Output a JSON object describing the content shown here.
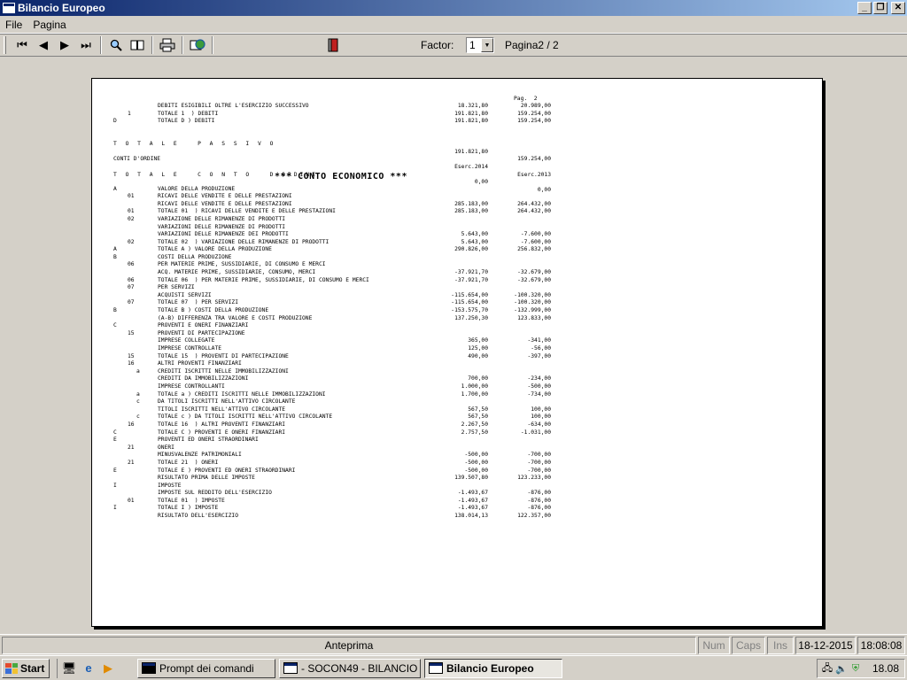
{
  "window": {
    "title": "Bilancio Europeo"
  },
  "menu": {
    "file": "File",
    "pagina": "Pagina"
  },
  "toolbar": {
    "factor_label": "Factor:",
    "factor_value": "1",
    "page_indicator": "Pagina2 / 2",
    "icons": [
      "first-page-icon",
      "prev-page-icon",
      "next-page-icon",
      "last-page-icon",
      "zoom-icon",
      "book-icon",
      "print-icon",
      "export-icon",
      "exit-door-icon"
    ]
  },
  "report": {
    "page_label": "Pag.  2",
    "section_title": "*** CONTO ECONOMICO ***",
    "rows_top": [
      {
        "c1": "",
        "c2": "",
        "c3": "",
        "desc": "DEBITI ESIGIBILI OLTRE L'ESERCIZIO SUCCESSIVO",
        "v1": "18.321,80",
        "v2": "20.989,00"
      },
      {
        "c1": "",
        "c2": "1",
        "c3": "",
        "desc": "TOTALE 1  ) DEBITI",
        "v1": "191.821,80",
        "v2": "159.254,00"
      },
      {
        "c1": "D",
        "c2": "",
        "c3": "",
        "desc": "TOTALE D ) DEBITI",
        "v1": "191.821,80",
        "v2": "159.254,00"
      }
    ],
    "totale_passivo": {
      "label": "T O T A L E   P A S S I V O",
      "v1": "191.821,80",
      "v2": "159.254,00"
    },
    "conti_ordine": {
      "label": "CONTI D'ORDINE",
      "v1": "Eserc.2014",
      "v2": "Eserc.2013"
    },
    "totale_conto_ordine": {
      "label": "T O T A L E   C O N T O   D'ORDINE",
      "v1": "0,00",
      "v2": "0,00"
    },
    "rows_ce": [
      {
        "c1": "A",
        "c2": "",
        "c3": "",
        "desc": "VALORE DELLA PRODUZIONE",
        "v1": "",
        "v2": ""
      },
      {
        "c1": "",
        "c2": "01",
        "c3": "",
        "desc": "RICAVI DELLE VENDITE E DELLE PRESTAZIONI",
        "v1": "",
        "v2": ""
      },
      {
        "c1": "",
        "c2": "",
        "c3": "",
        "desc": "RICAVI DELLE VENDITE E DELLE PRESTAZIONI",
        "v1": "285.183,00",
        "v2": "264.432,00"
      },
      {
        "c1": "",
        "c2": "01",
        "c3": "",
        "desc": "TOTALE 01  ) RICAVI DELLE VENDITE E DELLE PRESTAZIONI",
        "v1": "285.183,00",
        "v2": "264.432,00"
      },
      {
        "c1": "",
        "c2": "02",
        "c3": "",
        "desc": "VARIAZIONE DELLE RIMANENZE DI PRODOTTI",
        "v1": "",
        "v2": ""
      },
      {
        "c1": "",
        "c2": "",
        "c3": "",
        "desc": "VARIAZIONI DELLE RIMANENZE DI PRODOTTI",
        "v1": "",
        "v2": ""
      },
      {
        "c1": "",
        "c2": "",
        "c3": "",
        "desc": "VARIAZIONI DELLE RIMANENZE DEI PRODOTTI",
        "v1": "5.643,00",
        "v2": "-7.600,00"
      },
      {
        "c1": "",
        "c2": "02",
        "c3": "",
        "desc": "TOTALE 02  ) VARIAZIONE DELLE RIMANENZE DI PRODOTTI",
        "v1": "5.643,00",
        "v2": "-7.600,00"
      },
      {
        "c1": "A",
        "c2": "",
        "c3": "",
        "desc": "TOTALE A ) VALORE DELLA PRODUZIONE",
        "v1": "290.826,00",
        "v2": "256.832,00"
      },
      {
        "c1": "B",
        "c2": "",
        "c3": "",
        "desc": "COSTI DELLA PRODUZIONE",
        "v1": "",
        "v2": ""
      },
      {
        "c1": "",
        "c2": "06",
        "c3": "",
        "desc": "PER MATERIE PRIME, SUSSIDIARIE, DI CONSUMO E MERCI",
        "v1": "",
        "v2": ""
      },
      {
        "c1": "",
        "c2": "",
        "c3": "",
        "desc": "ACQ. MATERIE PRIME, SUSSIDIARIE, CONSUMO, MERCI",
        "v1": "-37.921,70",
        "v2": "-32.679,00"
      },
      {
        "c1": "",
        "c2": "06",
        "c3": "",
        "desc": "TOTALE 06  ) PER MATERIE PRIME, SUSSIDIARIE, DI CONSUMO E MERCI",
        "v1": "-37.921,70",
        "v2": "-32.679,00"
      },
      {
        "c1": "",
        "c2": "07",
        "c3": "",
        "desc": "PER SERVIZI",
        "v1": "",
        "v2": ""
      },
      {
        "c1": "",
        "c2": "",
        "c3": "",
        "desc": "ACQUISTI SERVIZI",
        "v1": "-115.654,00",
        "v2": "-100.320,00"
      },
      {
        "c1": "",
        "c2": "07",
        "c3": "",
        "desc": "TOTALE 07  ) PER SERVIZI",
        "v1": "-115.654,00",
        "v2": "-100.320,00"
      },
      {
        "c1": "B",
        "c2": "",
        "c3": "",
        "desc": "TOTALE B ) COSTI DELLA PRODUZIONE",
        "v1": "-153.575,70",
        "v2": "-132.999,00"
      },
      {
        "c1": "",
        "c2": "",
        "c3": "",
        "desc": "(A-B) DIFFERENZA TRA VALORE E COSTI PRODUZIONE",
        "v1": "137.250,30",
        "v2": "123.833,00"
      },
      {
        "c1": "C",
        "c2": "",
        "c3": "",
        "desc": "PROVENTI E ONERI FINANZIARI",
        "v1": "",
        "v2": ""
      },
      {
        "c1": "",
        "c2": "15",
        "c3": "",
        "desc": "PROVENTI DI PARTECIPAZIONE",
        "v1": "",
        "v2": ""
      },
      {
        "c1": "",
        "c2": "",
        "c3": "",
        "desc": "IMPRESE COLLEGATE",
        "v1": "365,00",
        "v2": "-341,00"
      },
      {
        "c1": "",
        "c2": "",
        "c3": "",
        "desc": "IMPRESE CONTROLLATE",
        "v1": "125,00",
        "v2": "-56,00"
      },
      {
        "c1": "",
        "c2": "15",
        "c3": "",
        "desc": "TOTALE 15  ) PROVENTI DI PARTECIPAZIONE",
        "v1": "490,00",
        "v2": "-397,00"
      },
      {
        "c1": "",
        "c2": "16",
        "c3": "",
        "desc": "ALTRI PROVENTI FINANZIARI",
        "v1": "",
        "v2": ""
      },
      {
        "c1": "",
        "c2": "",
        "c3": "a",
        "desc": "CREDITI ISCRITTI NELLE IMMOBILIZZAZIONI",
        "v1": "",
        "v2": ""
      },
      {
        "c1": "",
        "c2": "",
        "c3": "",
        "desc": "CREDITI DA IMMOBILIZZAZIONI",
        "v1": "700,00",
        "v2": "-234,00"
      },
      {
        "c1": "",
        "c2": "",
        "c3": "",
        "desc": "IMPRESE CONTROLLANTI",
        "v1": "1.000,00",
        "v2": "-500,00"
      },
      {
        "c1": "",
        "c2": "",
        "c3": "a",
        "desc": "TOTALE a ) CREDITI ISCRITTI NELLE IMMOBILIZZAZIONI",
        "v1": "1.700,00",
        "v2": "-734,00"
      },
      {
        "c1": "",
        "c2": "",
        "c3": "c",
        "desc": "DA TITOLI ISCRITTI NELL'ATTIVO CIRCOLANTE",
        "v1": "",
        "v2": ""
      },
      {
        "c1": "",
        "c2": "",
        "c3": "",
        "desc": "TITOLI ISCRITTI NELL'ATTIVO CIRCOLANTE",
        "v1": "567,50",
        "v2": "100,00"
      },
      {
        "c1": "",
        "c2": "",
        "c3": "c",
        "desc": "TOTALE c ) DA TITOLI ISCRITTI NELL'ATTIVO CIRCOLANTE",
        "v1": "567,50",
        "v2": "100,00"
      },
      {
        "c1": "",
        "c2": "16",
        "c3": "",
        "desc": "TOTALE 16  ) ALTRI PROVENTI FINANZIARI",
        "v1": "2.267,50",
        "v2": "-634,00"
      },
      {
        "c1": "C",
        "c2": "",
        "c3": "",
        "desc": "TOTALE C ) PROVENTI E ONERI FINANZIARI",
        "v1": "2.757,50",
        "v2": "-1.031,00"
      },
      {
        "c1": "E",
        "c2": "",
        "c3": "",
        "desc": "PROVENTI ED ONERI STRAORDINARI",
        "v1": "",
        "v2": ""
      },
      {
        "c1": "",
        "c2": "21",
        "c3": "",
        "desc": "ONERI",
        "v1": "",
        "v2": ""
      },
      {
        "c1": "",
        "c2": "",
        "c3": "",
        "desc": "MINUSVALENZE PATRIMONIALI",
        "v1": "-500,00",
        "v2": "-700,00"
      },
      {
        "c1": "",
        "c2": "21",
        "c3": "",
        "desc": "TOTALE 21  ) ONERI",
        "v1": "-500,00",
        "v2": "-700,00"
      },
      {
        "c1": "E",
        "c2": "",
        "c3": "",
        "desc": "TOTALE E ) PROVENTI ED ONERI STRAORDINARI",
        "v1": "-500,00",
        "v2": "-700,00"
      },
      {
        "c1": "",
        "c2": "",
        "c3": "",
        "desc": "RISULTATO PRIMA DELLE IMPOSTE",
        "v1": "139.507,80",
        "v2": "123.233,00"
      },
      {
        "c1": "I",
        "c2": "",
        "c3": "",
        "desc": "IMPOSTE",
        "v1": "",
        "v2": ""
      },
      {
        "c1": "",
        "c2": "",
        "c3": "",
        "desc": "IMPOSTE SUL REDDITO DELL'ESERCIZIO",
        "v1": "-1.493,67",
        "v2": "-876,00"
      },
      {
        "c1": "",
        "c2": "01",
        "c3": "",
        "desc": "TOTALE 01  ) IMPOSTE",
        "v1": "-1.493,67",
        "v2": "-876,00"
      },
      {
        "c1": "I",
        "c2": "",
        "c3": "",
        "desc": "TOTALE I ) IMPOSTE",
        "v1": "-1.493,67",
        "v2": "-876,00"
      },
      {
        "c1": "",
        "c2": "",
        "c3": "",
        "desc": "RISULTATO DELL'ESERCIZIO",
        "v1": "138.014,13",
        "v2": "122.357,00"
      }
    ]
  },
  "statusbar": {
    "mode": "Anteprima",
    "num": "Num",
    "caps": "Caps",
    "ins": "Ins",
    "date": "18-12-2015",
    "time": "18:08:08"
  },
  "taskbar": {
    "start_label": "Start",
    "tasks": [
      {
        "label": "Prompt dei comandi",
        "active": false,
        "icon": "cmd"
      },
      {
        "label": "- SOCON49 - BILANCIO ...",
        "active": false,
        "icon": "window"
      },
      {
        "label": "Bilancio Europeo",
        "active": true,
        "icon": "window"
      }
    ],
    "clock": "18.08"
  }
}
